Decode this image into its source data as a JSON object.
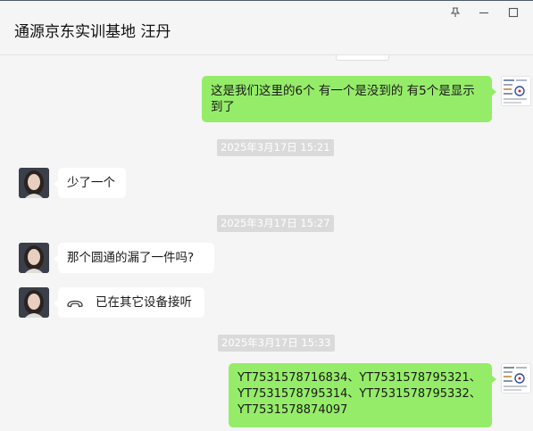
{
  "window": {
    "title": "通源京东实训基地 汪丹",
    "controls": [
      "pin-icon",
      "minimize-icon",
      "maximize-icon"
    ]
  },
  "messages": [
    {
      "sender": "self",
      "text": "这是我们这里的6个 有一个是没到的 有5个是显示到了"
    },
    {
      "type": "timestamp",
      "text": "2025年3月17日 15:21"
    },
    {
      "sender": "contact",
      "text": "少了一个"
    },
    {
      "type": "timestamp",
      "text": "2025年3月17日 15:27"
    },
    {
      "sender": "contact",
      "text": "那个圆通的漏了一件吗?"
    },
    {
      "sender": "contact",
      "type": "call",
      "icon": "phone-icon",
      "text": "已在其它设备接听"
    },
    {
      "type": "timestamp",
      "text": "2025年3月17日 15:33"
    },
    {
      "sender": "self",
      "text": "YT7531578716834、YT7531578795321、YT7531578795314、YT7531578795332、YT7531578874097"
    }
  ],
  "colors": {
    "self_bubble": "#95ec69",
    "other_bubble": "#ffffff",
    "background": "#f5f5f5",
    "timestamp_bg": "#dadada"
  }
}
